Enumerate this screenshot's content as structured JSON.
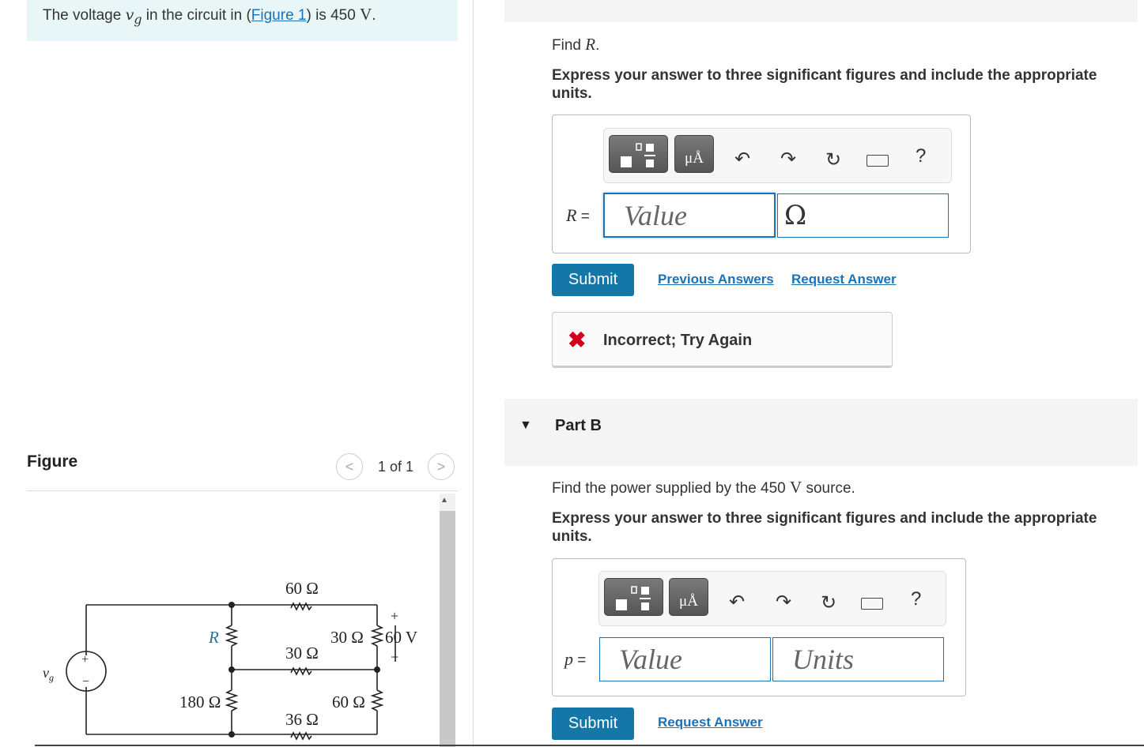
{
  "problem": {
    "prefix": "The voltage ",
    "var": "v",
    "sub": "g",
    "middle": " in the circuit in (",
    "link": "Figure 1",
    "after": ") is 450 ",
    "unit": "V",
    "end": "."
  },
  "figure": {
    "label": "Figure",
    "prev": "<",
    "next": ">",
    "count": "1 of 1",
    "circuit": {
      "r60_top": "60 Ω",
      "r_label": "R",
      "r30_mid": "30 Ω",
      "r30_right": "30 Ω",
      "v60": "60 V",
      "plus": "+",
      "minus": "−",
      "source": "v",
      "source_sub": "g",
      "r180": "180 Ω",
      "r36": "36 Ω",
      "r60_bot": "60 Ω",
      "src_plus": "+",
      "src_minus": "−"
    }
  },
  "partA": {
    "question_prefix": "Find ",
    "question_var": "R",
    "question_end": ".",
    "instruction": "Express your answer to three significant figures and include the appropriate units.",
    "field_var": "R",
    "field_eq": " =",
    "value_placeholder": "Value",
    "unit_value": "Ω",
    "submit": "Submit",
    "previous_answers": "Previous Answers",
    "request_answer": "Request Answer",
    "feedback_icon": "✖",
    "feedback": "Incorrect; Try Again",
    "toolbar": {
      "units_btn": "μÅ",
      "help": "?"
    }
  },
  "partB": {
    "toggle": "▼",
    "title": "Part B",
    "question_prefix": "Find the power supplied by the 450 ",
    "question_unit": "V",
    "question_end": " source.",
    "instruction": "Express your answer to three significant figures and include the appropriate units.",
    "field_var": "p",
    "field_eq": " =",
    "value_placeholder": "Value",
    "units_placeholder": "Units",
    "submit": "Submit",
    "request_answer": "Request Answer",
    "toolbar": {
      "units_btn": "μÅ",
      "help": "?"
    }
  },
  "colors": {
    "accent": "#1576a8",
    "error": "#d0021b",
    "problem_bg": "#e8f6f7"
  }
}
